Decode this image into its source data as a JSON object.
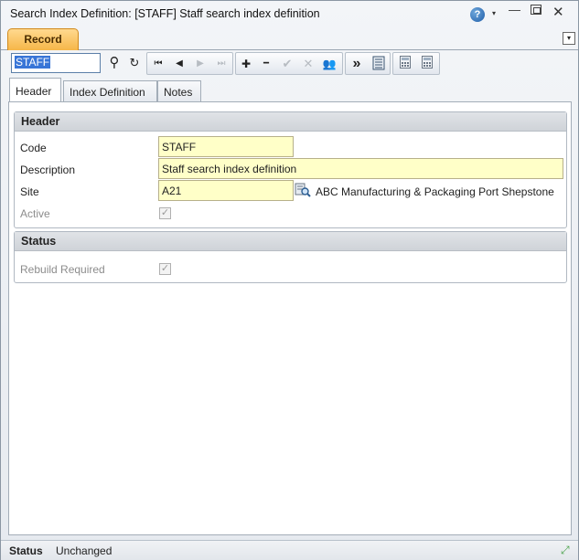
{
  "window": {
    "title": "Search Index Definition: [STAFF] Staff search index definition",
    "controls": {
      "help": "?",
      "help_caret": "▾",
      "minimize": "—",
      "close": "✕"
    }
  },
  "ribbon": {
    "tab_label": "Record",
    "menu_glyph": "▾"
  },
  "toolbar": {
    "search_value": "STAFF",
    "icons": {
      "search": "⚲",
      "refresh": "↻",
      "first": "⏮",
      "prev": "◀",
      "next": "▶",
      "last": "⏭",
      "add": "✚",
      "remove": "━",
      "save": "✔",
      "cancel": "✕",
      "users": "👥",
      "more": "»"
    }
  },
  "tabs": [
    "Header",
    "Index Definition",
    "Notes"
  ],
  "header_section": {
    "title": "Header",
    "code_label": "Code",
    "code_value": "STAFF",
    "description_label": "Description",
    "description_value": "Staff search index definition",
    "site_label": "Site",
    "site_value": "A21",
    "site_description": "ABC Manufacturing & Packaging Port Shepstone",
    "active_label": "Active",
    "active_checked": true
  },
  "status_section": {
    "title": "Status",
    "rebuild_label": "Rebuild Required",
    "rebuild_checked": true
  },
  "statusbar": {
    "label": "Status",
    "value": "Unchanged"
  }
}
